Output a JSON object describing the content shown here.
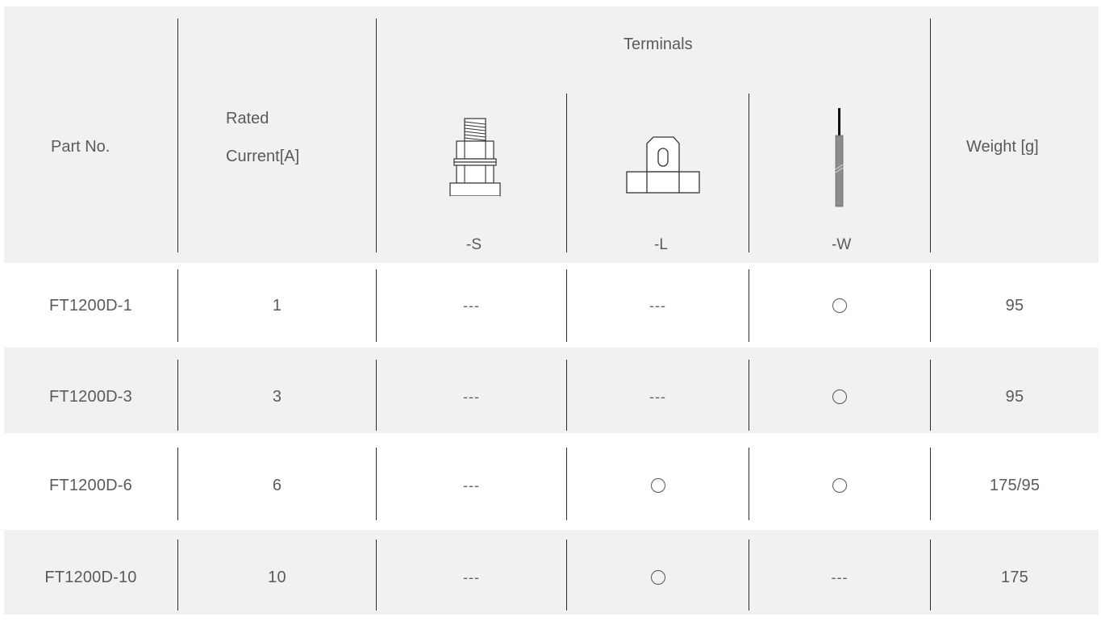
{
  "header": {
    "part_no": "Part No.",
    "rated_line1": "Rated",
    "rated_line2": "Current[A]",
    "terminals": "Terminals",
    "term_s": "-S",
    "term_l": "-L",
    "term_w": "-W",
    "weight": "Weight [g]"
  },
  "rows": [
    {
      "part": "FT1200D-1",
      "current": "1",
      "s": "---",
      "l": "---",
      "w": "○",
      "weight": "95"
    },
    {
      "part": "FT1200D-3",
      "current": "3",
      "s": "---",
      "l": "---",
      "w": "○",
      "weight": "95"
    },
    {
      "part": "FT1200D-6",
      "current": "6",
      "s": "---",
      "l": "○",
      "w": "○",
      "weight": "175/95"
    },
    {
      "part": "FT1200D-10",
      "current": "10",
      "s": "---",
      "l": "○",
      "w": "---",
      "weight": "175"
    }
  ],
  "icons": {
    "s": "screw-terminal-icon",
    "l": "lug-terminal-icon",
    "w": "wire-terminal-icon",
    "available": "circle-mark-icon"
  },
  "colors": {
    "band": "#f1f1f1",
    "line": "#2a2a2a",
    "text": "#5a5a5a"
  }
}
